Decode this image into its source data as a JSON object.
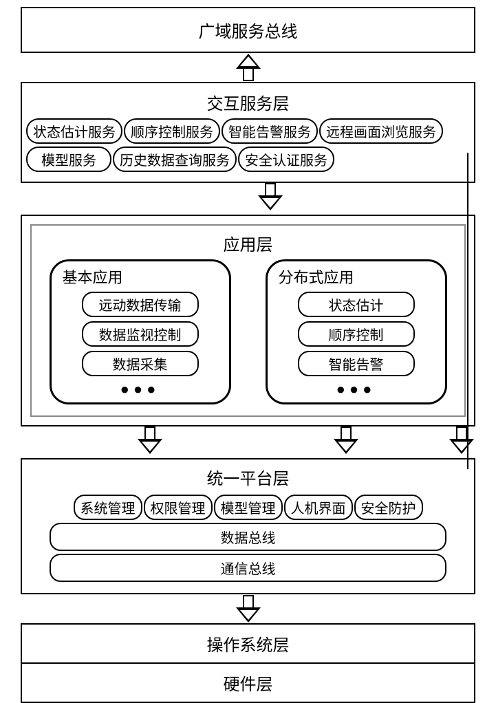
{
  "layers": {
    "wan_bus": "广域服务总线",
    "interaction": {
      "title": "交互服务层",
      "row1": [
        "状态估计服务",
        "顺序控制服务",
        "智能告警服务",
        "远程画面浏览服务"
      ],
      "row2": [
        "模型服务",
        "历史数据查询服务",
        "安全认证服务"
      ]
    },
    "application": {
      "title": "应用层",
      "basic": {
        "title": "基本应用",
        "items": [
          "远动数据传输",
          "数据监视控制",
          "数据采集"
        ]
      },
      "distributed": {
        "title": "分布式应用",
        "items": [
          "状态估计",
          "顺序控制",
          "智能告警"
        ]
      }
    },
    "platform": {
      "title": "统一平台层",
      "row": [
        "系统管理",
        "权限管理",
        "模型管理",
        "人机界面",
        "安全防护"
      ],
      "data_bus": "数据总线",
      "comm_bus": "通信总线"
    },
    "os": "操作系统层",
    "hardware": "硬件层"
  }
}
